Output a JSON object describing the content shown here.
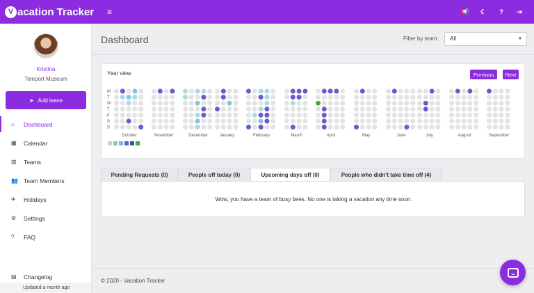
{
  "app": {
    "logo_letter": "V",
    "logo_text": "acation Tracker"
  },
  "topbar": {
    "menu_icon": "≡",
    "icons": [
      "megaphone-icon",
      "moon-icon",
      "help-icon",
      "logout-icon"
    ],
    "icon_glyphs": [
      "📢",
      "☾",
      "?",
      "⇥"
    ]
  },
  "user": {
    "name": "Kristina",
    "org": "Teleport Museum"
  },
  "sidebar": {
    "add_leave": "Add leave",
    "items": [
      {
        "label": "Dashboard",
        "icon": "home-icon",
        "glyph": "⌂"
      },
      {
        "label": "Calendar",
        "icon": "calendar-icon",
        "glyph": "▦"
      },
      {
        "label": "Teams",
        "icon": "building-icon",
        "glyph": "▥"
      },
      {
        "label": "Team Members",
        "icon": "users-icon",
        "glyph": "👥"
      },
      {
        "label": "Holidays",
        "icon": "plane-icon",
        "glyph": "✈"
      },
      {
        "label": "Settings",
        "icon": "gear-icon",
        "glyph": "⚙"
      },
      {
        "label": "FAQ",
        "icon": "question-circle-icon",
        "glyph": "?"
      }
    ],
    "changelog": "Changelog",
    "updated": "Updated a month ago"
  },
  "page": {
    "title": "Dashboard",
    "filter_label": "Filter by team:",
    "filter_value": "All"
  },
  "year_view": {
    "title": "Year view",
    "prev": "Previous",
    "next": "Next",
    "day_labels": [
      "M",
      "T",
      "W",
      "T",
      "F",
      "S",
      "S"
    ],
    "months": [
      "October",
      "November",
      "December",
      "January",
      "February",
      "March",
      "April",
      "May",
      "June",
      "July",
      "August",
      "September"
    ],
    "colors": {
      "empty": "#e3e3e3",
      "light": "#a8dbe8",
      "mid": "#7ec8dc",
      "dark": "#6a5acd",
      "today": "#3cb043"
    },
    "legend": [
      "#a8dbe8",
      "#7ec8dc",
      "#9aa8d8",
      "#6a5acd",
      "#4a4aa0",
      "#3cb043"
    ]
  },
  "tabs": [
    {
      "label": "Pending Requests (0)"
    },
    {
      "label": "People off today (0)"
    },
    {
      "label": "Upcoming days off (0)"
    },
    {
      "label": "People who didn't take time off (4)"
    }
  ],
  "tab_panel": {
    "message": "Wow, you have a team of busy bees. No one is taking a vacation any time soon."
  },
  "footer": {
    "text": "© 2020 - Vacation Tracker"
  }
}
